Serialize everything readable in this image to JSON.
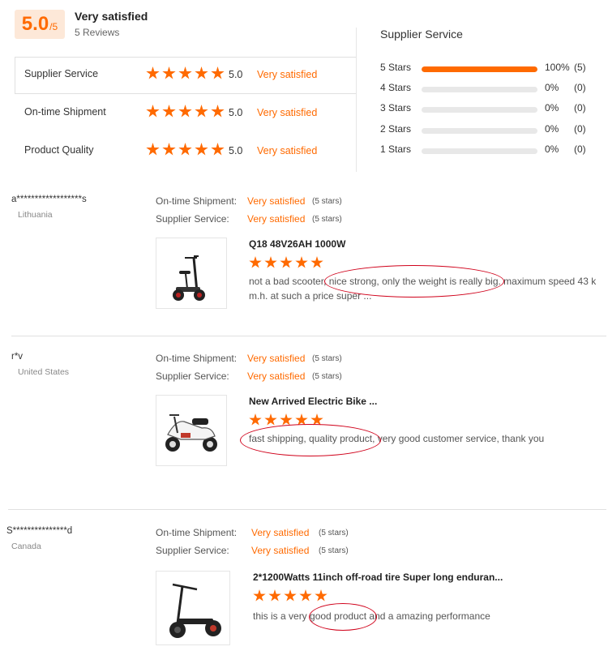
{
  "summary": {
    "score": "5.0",
    "score_denominator": "/5",
    "overall_label": "Very satisfied",
    "review_count": "5 Reviews",
    "categories": [
      {
        "name": "Supplier Service",
        "score": "5.0",
        "satisfaction": "Very satisfied",
        "stars": 5
      },
      {
        "name": "On-time Shipment",
        "score": "5.0",
        "satisfaction": "Very satisfied",
        "stars": 5
      },
      {
        "name": "Product Quality",
        "score": "5.0",
        "satisfaction": "Very satisfied",
        "stars": 5
      }
    ]
  },
  "breakdown": {
    "title": "Supplier Service",
    "rows": [
      {
        "label": "5  Stars",
        "fraction": 1.0,
        "percent": "100%",
        "count": "(5)"
      },
      {
        "label": "4  Stars",
        "fraction": 0.0,
        "percent": "0%",
        "count": "(0)"
      },
      {
        "label": "3  Stars",
        "fraction": 0.0,
        "percent": "0%",
        "count": "(0)"
      },
      {
        "label": "2  Stars",
        "fraction": 0.0,
        "percent": "0%",
        "count": "(0)"
      },
      {
        "label": "1  Stars",
        "fraction": 0.0,
        "percent": "0%",
        "count": "(0)"
      }
    ]
  },
  "reviews": [
    {
      "user": "a******************s",
      "country": "Lithuania",
      "ontime_label": "On-time Shipment:",
      "ontime_value": "Very satisfied",
      "ontime_stars": "(5 stars)",
      "supplier_label": "Supplier Service:",
      "supplier_value": "Very satisfied",
      "supplier_stars": "(5 stars)",
      "product_title": "Q18 48V26AH 1000W",
      "rating": 5,
      "text_line1": "not a bad scooter, nice strong, only the weight is really big. maximum speed 43 k",
      "text_line2": "m.h.  at such a price super ...",
      "product_icon": "scooter-seat-image"
    },
    {
      "user": "r*v",
      "country": "United States",
      "ontime_label": "On-time Shipment:",
      "ontime_value": "Very satisfied",
      "ontime_stars": "(5 stars)",
      "supplier_label": "Supplier Service:",
      "supplier_value": "Very satisfied",
      "supplier_stars": "(5 stars)",
      "product_title": "New Arrived Electric Bike ...",
      "rating": 5,
      "text_line1": "fast shipping, quality product, very good customer service, thank you",
      "text_line2": "",
      "product_icon": "electric-bike-image"
    },
    {
      "user": "S***************d",
      "country": "Canada",
      "ontime_label": "On-time Shipment:",
      "ontime_value": "Very satisfied",
      "ontime_stars": "(5 stars)",
      "supplier_label": "Supplier Service:",
      "supplier_value": "Very satisfied",
      "supplier_stars": "(5 stars)",
      "product_title": "2*1200Watts 11inch off-road tire Super long enduran...",
      "rating": 5,
      "text_line1": "this is a very good product and a amazing performance",
      "text_line2": "",
      "product_icon": "offroad-scooter-image"
    }
  ],
  "colors": {
    "accent": "#ff6a00",
    "annotation": "#d0021b",
    "score_bg": "#fde8d8"
  }
}
